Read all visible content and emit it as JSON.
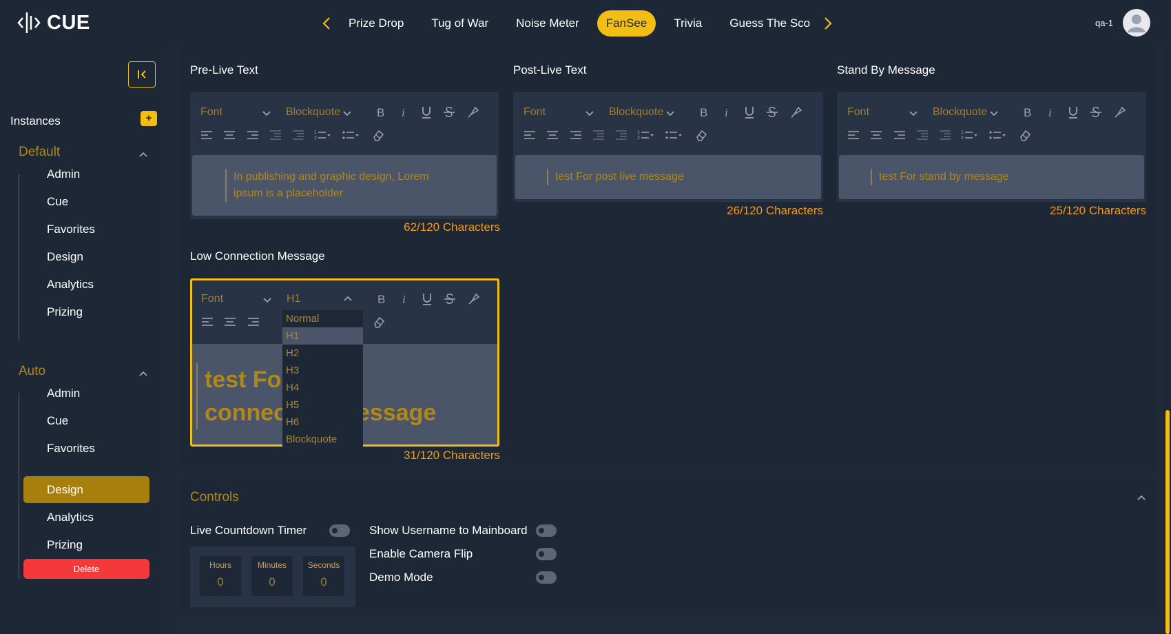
{
  "app": {
    "logo_text": "CUE"
  },
  "nav": {
    "tabs": [
      "Prize Drop",
      "Tug of War",
      "Noise Meter",
      "FanSee",
      "Trivia",
      "Guess The Sco"
    ],
    "active_tab": "FanSee"
  },
  "user": {
    "name": "qa-1"
  },
  "sidebar": {
    "instances_title": "Instances",
    "add_label": "+",
    "groups": [
      {
        "title": "Default",
        "items": [
          "Admin",
          "Cue",
          "Favorites",
          "Design",
          "Analytics",
          "Prizing"
        ]
      },
      {
        "title": "Auto",
        "items": [
          "Admin",
          "Cue",
          "Favorites",
          "Design",
          "Analytics",
          "Prizing"
        ],
        "active_item": "Design"
      }
    ],
    "delete_label": "Delete"
  },
  "editors": {
    "font_label": "Font",
    "pre_live": {
      "label": "Pre-Live Text",
      "format": "Blockquote",
      "text": "In publishing and graphic design, Lorem ipsum is a placeholder",
      "count": "62/120 Characters"
    },
    "post_live": {
      "label": "Post-Live Text",
      "format": "Blockquote",
      "text": "test For post live message",
      "count": "26/120 Characters"
    },
    "stand_by": {
      "label": "Stand By Message",
      "format": "Blockquote",
      "text": "test For stand by message",
      "count": "25/120 Characters"
    },
    "low_connection": {
      "label": "Low Connection Message",
      "format": "H1",
      "text": "test For low connection message",
      "count": "31/120 Characters"
    }
  },
  "format_dropdown": {
    "options": [
      "Normal",
      "H1",
      "H2",
      "H3",
      "H4",
      "H5",
      "H6",
      "Blockquote"
    ],
    "selected": "H1"
  },
  "controls": {
    "title": "Controls",
    "live_countdown": "Live Countdown Timer",
    "show_username": "Show Username to Mainboard",
    "camera_flip": "Enable Camera Flip",
    "demo_mode": "Demo Mode",
    "timer": {
      "hours_label": "Hours",
      "hours": "0",
      "minutes_label": "Minutes",
      "minutes": "0",
      "seconds_label": "Seconds",
      "seconds": "0"
    }
  },
  "colors": {
    "accent": "#f3be14",
    "background": "#202938",
    "panel": "#1e2736",
    "danger": "#f5383c",
    "gold_text": "#b18818",
    "count_text": "#f39a1c"
  }
}
